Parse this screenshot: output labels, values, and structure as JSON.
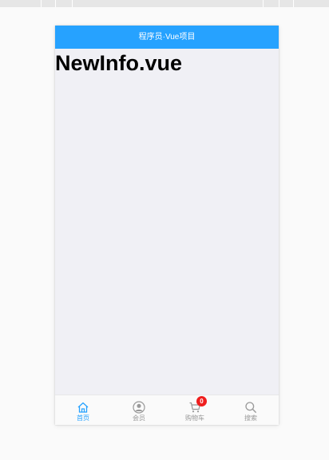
{
  "header": {
    "title": "程序员·Vue项目"
  },
  "content": {
    "heading": "NewInfo.vue"
  },
  "tabbar": {
    "items": [
      {
        "label": "首页",
        "icon": "home-icon",
        "active": true
      },
      {
        "label": "会员",
        "icon": "member-icon",
        "active": false
      },
      {
        "label": "购物车",
        "icon": "cart-icon",
        "active": false,
        "badge": "0"
      },
      {
        "label": "搜索",
        "icon": "search-icon",
        "active": false
      }
    ]
  },
  "colors": {
    "header_bg": "#26a2ff",
    "active_tab": "#26a2ff",
    "inactive_tab": "#999999",
    "badge_bg": "#ef1e1e",
    "content_bg": "#f0f0f5"
  }
}
